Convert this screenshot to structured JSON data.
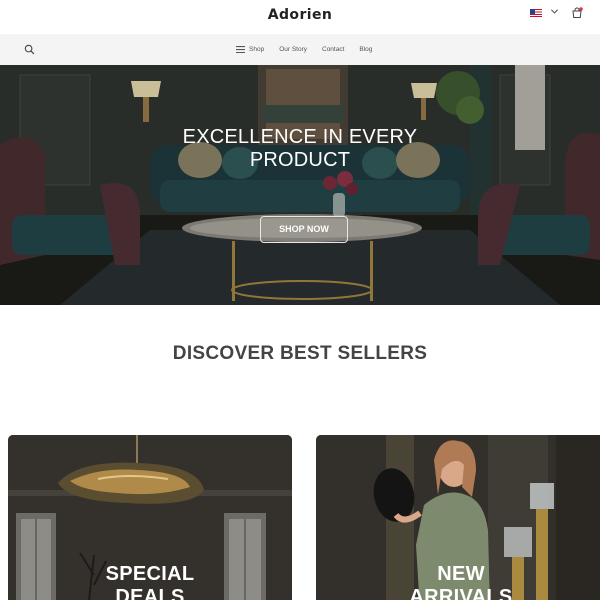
{
  "header": {
    "logo": "Adorien",
    "locale_flag": "us-flag-icon",
    "icons": [
      "search-icon",
      "chevron-down-icon",
      "cart-icon",
      "menu-icon"
    ]
  },
  "nav": {
    "items": [
      {
        "label": "Shop"
      },
      {
        "label": "Our Story"
      },
      {
        "label": "Contact"
      },
      {
        "label": "Blog"
      }
    ]
  },
  "hero": {
    "title_line1": "EXCELLENCE IN EVERY",
    "title_line2": "PRODUCT",
    "cta": "SHOP NOW"
  },
  "best_sellers": {
    "title": "DISCOVER BEST SELLERS"
  },
  "cards": [
    {
      "line1": "SPECIAL",
      "line2": "DEALS"
    },
    {
      "line1": "NEW",
      "line2": "ARRIVALS"
    }
  ],
  "colors": {
    "text_dark": "#222222",
    "nav_bg": "#f4f4f4",
    "cart_badge": "#e0344c"
  }
}
